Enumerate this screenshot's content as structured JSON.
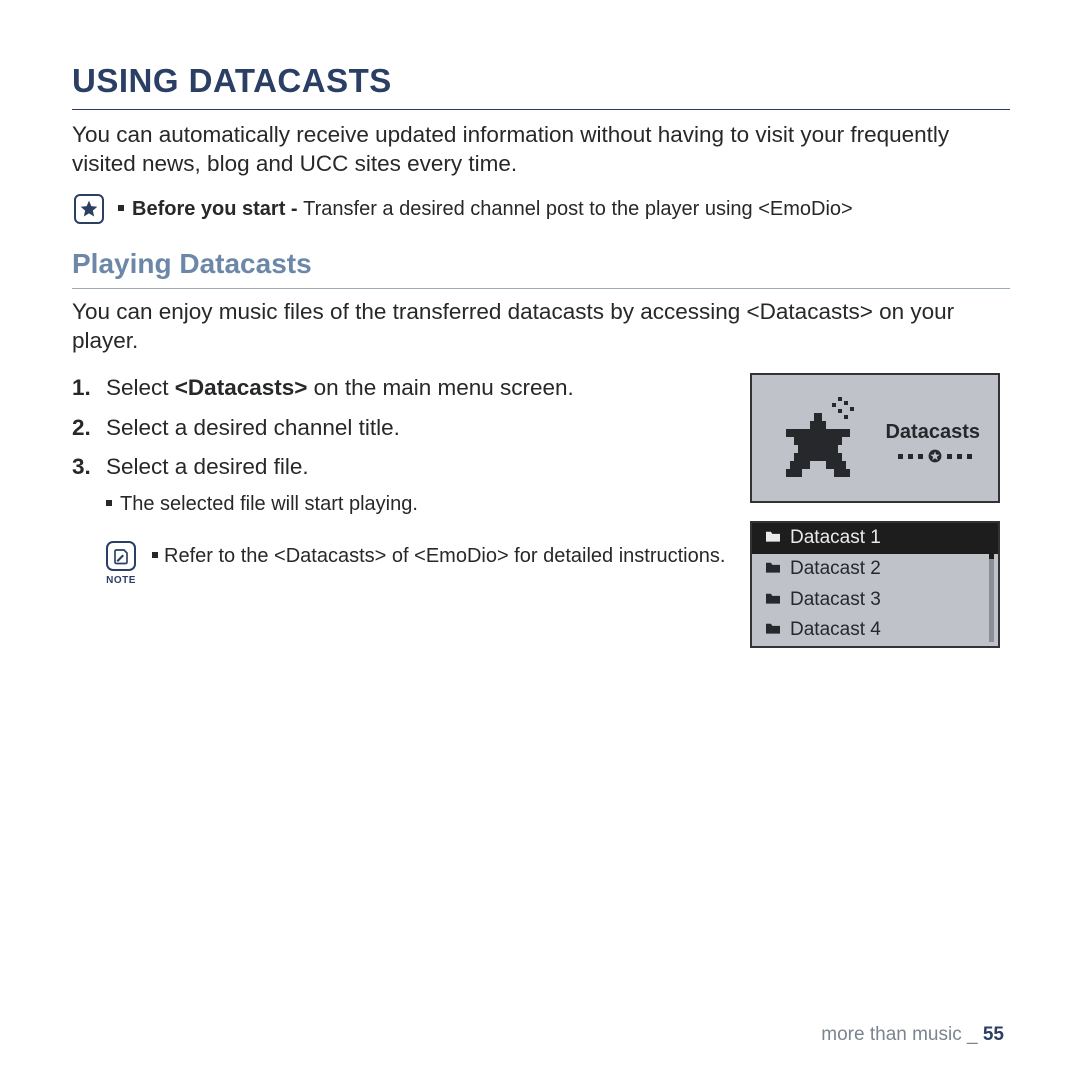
{
  "h1": "USING DATACASTS",
  "intro": "You can automatically receive updated information without having to visit your frequently visited news, blog and UCC sites every time.",
  "before": {
    "lead": "Before you start - ",
    "rest": "Transfer a desired channel post to the player using <EmoDio>"
  },
  "h2": "Playing Datacasts",
  "sub_intro": "You can enjoy music files of the transferred datacasts by accessing <Datacasts> on your player.",
  "steps": [
    {
      "num": "1.",
      "pre": "Select ",
      "bold": "<Datacasts>",
      "post": " on the main menu screen."
    },
    {
      "num": "2.",
      "pre": "Select a desired channel title.",
      "bold": "",
      "post": ""
    },
    {
      "num": "3.",
      "pre": "Select a desired file.",
      "bold": "",
      "post": ""
    }
  ],
  "step3_sub": "The selected file will start playing.",
  "note": {
    "label": "NOTE",
    "text": "Refer to the <Datacasts> of <EmoDio> for detailed instructions."
  },
  "screen1_label": "Datacasts",
  "list": [
    {
      "label": "Datacast 1",
      "selected": true
    },
    {
      "label": "Datacast 2",
      "selected": false
    },
    {
      "label": "Datacast 3",
      "selected": false
    },
    {
      "label": "Datacast 4",
      "selected": false
    }
  ],
  "footer": {
    "section": "more than music",
    "sep": " _ ",
    "page": "55"
  }
}
